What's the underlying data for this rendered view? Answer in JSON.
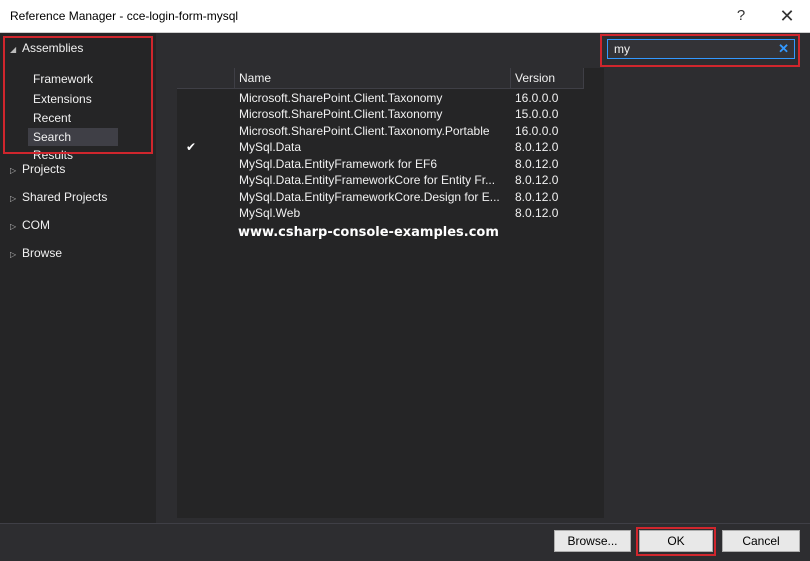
{
  "window": {
    "title": "Reference Manager - cce-login-form-mysql",
    "help": "?",
    "close": "✕"
  },
  "sidebar": {
    "assemblies": "Assemblies",
    "assembly_items": [
      "Framework",
      "Extensions",
      "Recent",
      "Search Results"
    ],
    "selected": "Search Results",
    "nodes": [
      "Projects",
      "Shared Projects",
      "COM",
      "Browse"
    ]
  },
  "search": {
    "value": "my",
    "clear": "✕"
  },
  "table": {
    "columns": [
      "Name",
      "Version"
    ],
    "rows": [
      {
        "name": "Microsoft.SharePoint.Client.Taxonomy",
        "version": "16.0.0.0",
        "checked": false
      },
      {
        "name": "Microsoft.SharePoint.Client.Taxonomy",
        "version": "15.0.0.0",
        "checked": false
      },
      {
        "name": "Microsoft.SharePoint.Client.Taxonomy.Portable",
        "version": "16.0.0.0",
        "checked": false
      },
      {
        "name": "MySql.Data",
        "version": "8.0.12.0",
        "checked": true
      },
      {
        "name": "MySql.Data.EntityFramework for EF6",
        "version": "8.0.12.0",
        "checked": false
      },
      {
        "name": "MySql.Data.EntityFrameworkCore for Entity Fr...",
        "version": "8.0.12.0",
        "checked": false
      },
      {
        "name": "MySql.Data.EntityFrameworkCore.Design for E...",
        "version": "8.0.12.0",
        "checked": false
      },
      {
        "name": "MySql.Web",
        "version": "8.0.12.0",
        "checked": false
      }
    ],
    "check_glyph": "✔"
  },
  "watermark": "www.csharp-console-examples.com",
  "buttons": {
    "browse": "Browse...",
    "ok": "OK",
    "cancel": "Cancel"
  },
  "colors": {
    "highlight": "#d0262d",
    "accent": "#3399ff"
  }
}
